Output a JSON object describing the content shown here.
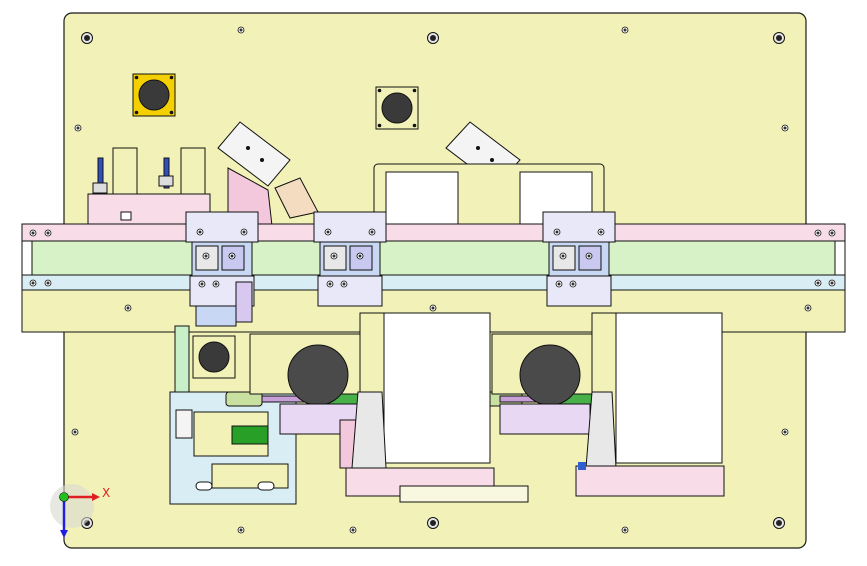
{
  "viewport": {
    "background": "#ffffff",
    "plate_color": "#f2f2b8",
    "rail_color": "#d8f2c8",
    "pink_color": "#f4c8dc",
    "blue_color": "#c8d8f4",
    "line_color": "#1a1a1a"
  },
  "triad": {
    "x_label": "X",
    "x_color": "#e02020",
    "y_color": "#2020e0",
    "origin_color": "#20c020"
  },
  "icons": {
    "triad": "axis-triad-icon"
  }
}
